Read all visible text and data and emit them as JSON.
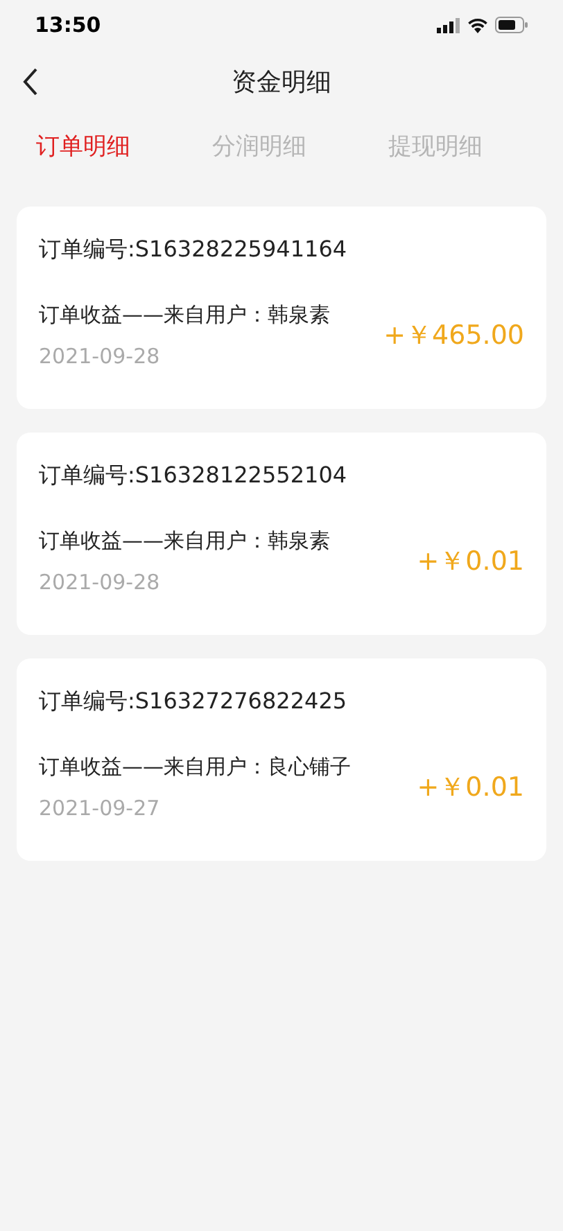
{
  "status_bar": {
    "time": "13:50"
  },
  "header": {
    "title": "资金明细"
  },
  "tabs": [
    {
      "label": "订单明细",
      "selected": true
    },
    {
      "label": "分润明细",
      "selected": false
    },
    {
      "label": "提现明细",
      "selected": false
    }
  ],
  "records": [
    {
      "order_no": "订单编号:S16328225941164",
      "description": "订单收益——来自用户：韩泉素",
      "date": "2021-09-28",
      "amount": "+￥465.00"
    },
    {
      "order_no": "订单编号:S16328122552104",
      "description": "订单收益——来自用户：韩泉素",
      "date": "2021-09-28",
      "amount": "+￥0.01"
    },
    {
      "order_no": "订单编号:S16327276822425",
      "description": "订单收益——来自用户：良心铺子",
      "date": "2021-09-27",
      "amount": "+￥0.01"
    }
  ]
}
